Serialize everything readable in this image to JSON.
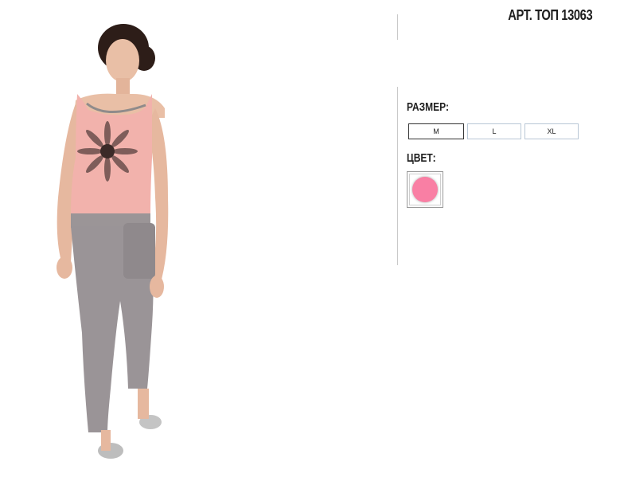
{
  "product": {
    "article": "АРТ. ТОП 13063"
  },
  "size": {
    "label": "РАЗМЕР:",
    "options": [
      "M",
      "L",
      "XL"
    ],
    "selected": "M"
  },
  "color": {
    "label": "ЦВЕТ:",
    "swatches": [
      {
        "hex": "#f97fa4"
      }
    ]
  },
  "colors": {
    "top": "#f2b2ac",
    "pants": "#9a9497",
    "skin": "#e9bfa6",
    "hair": "#2d1d18"
  }
}
